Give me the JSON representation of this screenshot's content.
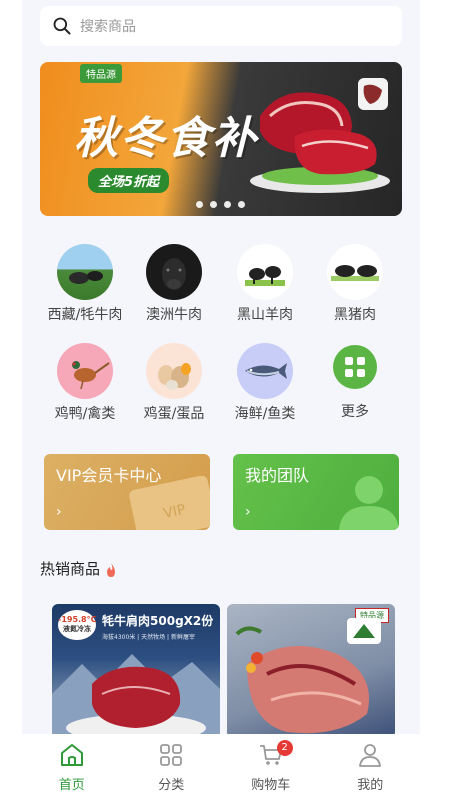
{
  "search": {
    "placeholder": "搜索商品"
  },
  "banner": {
    "brand": "特品源",
    "headline": "秋冬食补",
    "promo": "全场5折起",
    "slide_count": 4
  },
  "categories": [
    {
      "label": "西藏/牦牛肉",
      "icon": "yak-image"
    },
    {
      "label": "澳洲牛肉",
      "icon": "black-cattle-image"
    },
    {
      "label": "黑山羊肉",
      "icon": "black-goat-image"
    },
    {
      "label": "黑猪肉",
      "icon": "black-pig-image"
    },
    {
      "label": "鸡鸭/禽类",
      "icon": "pheasant-image"
    },
    {
      "label": "鸡蛋/蛋品",
      "icon": "eggs-image"
    },
    {
      "label": "海鲜/鱼类",
      "icon": "fish-image"
    },
    {
      "label": "更多",
      "icon": "grid-more-icon"
    }
  ],
  "cards": {
    "vip": {
      "title": "VIP会员卡中心",
      "chev": "›"
    },
    "team": {
      "title": "我的团队",
      "chev": "›"
    }
  },
  "hot": {
    "title": "热销商品"
  },
  "products": [
    {
      "temp": "-195.8°C",
      "sub": "液氮冷冻",
      "name": "牦牛肩肉",
      "spec": "500gX2份",
      "note": "海拔4300米 | 天然牧场 | 新鲜屠宰"
    },
    {
      "brand": "特品源"
    }
  ],
  "tabbar": [
    {
      "label": "首页",
      "icon": "home-icon",
      "active": true
    },
    {
      "label": "分类",
      "icon": "category-grid-icon"
    },
    {
      "label": "购物车",
      "icon": "cart-icon",
      "badge": "2"
    },
    {
      "label": "我的",
      "icon": "user-icon"
    }
  ],
  "colors": {
    "accent": "#2e9a3a",
    "vip": "#d9a95a",
    "team": "#5ab544",
    "badge": "#e53935"
  }
}
